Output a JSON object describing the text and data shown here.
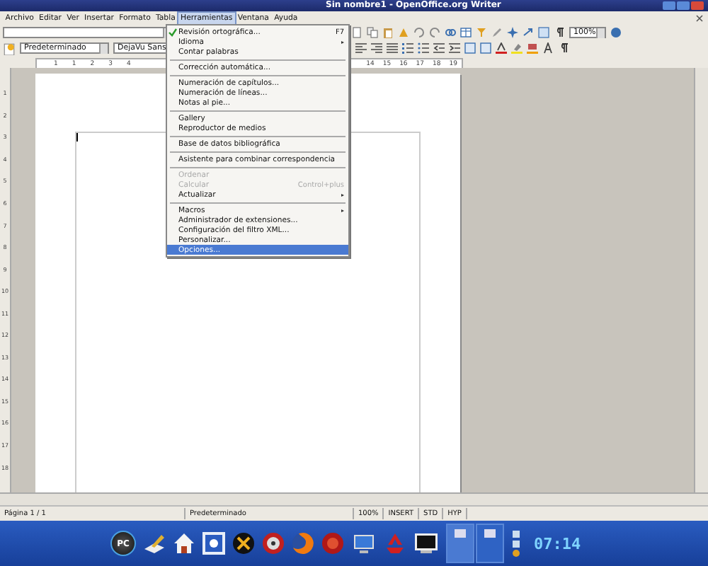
{
  "window": {
    "title": "Sin nombre1 - OpenOffice.org Writer"
  },
  "menu_bar": [
    {
      "label": "Archivo",
      "selected": false
    },
    {
      "label": "Editar",
      "selected": false
    },
    {
      "label": "Ver",
      "selected": false
    },
    {
      "label": "Insertar",
      "selected": false
    },
    {
      "label": "Formato",
      "selected": false
    },
    {
      "label": "Tabla",
      "selected": false
    },
    {
      "label": "Herramientas",
      "selected": true
    },
    {
      "label": "Ventana",
      "selected": false
    },
    {
      "label": "Ayuda",
      "selected": false
    }
  ],
  "toolbar": {
    "zoom": "100%"
  },
  "formatting": {
    "paragraph_style": "Predeterminado",
    "font_name": "DejaVu Sans"
  },
  "ruler": {
    "left_marks": [
      "1",
      "1",
      "2",
      "3",
      "4"
    ],
    "right_marks": [
      "14",
      "15",
      "16",
      "17",
      "18",
      "19"
    ],
    "vertical_marks": [
      "1",
      "2",
      "3",
      "4",
      "5",
      "6",
      "7",
      "8",
      "9",
      "10",
      "11",
      "12",
      "13",
      "14",
      "15",
      "16",
      "17",
      "18"
    ]
  },
  "open_menu": [
    {
      "kind": "item",
      "label": "Revisión ortográfica...",
      "shortcut": "F7",
      "submenu": false,
      "disabled": false,
      "selected": false,
      "icon": true
    },
    {
      "kind": "item",
      "label": "Idioma",
      "submenu": true,
      "disabled": false,
      "selected": false
    },
    {
      "kind": "item",
      "label": "Contar palabras",
      "submenu": false,
      "disabled": false,
      "selected": false
    },
    {
      "kind": "separator"
    },
    {
      "kind": "item",
      "label": "Corrección automática...",
      "submenu": false,
      "disabled": false,
      "selected": false
    },
    {
      "kind": "separator"
    },
    {
      "kind": "item",
      "label": "Numeración de capítulos...",
      "submenu": false,
      "disabled": false,
      "selected": false
    },
    {
      "kind": "item",
      "label": "Numeración de líneas...",
      "submenu": false,
      "disabled": false,
      "selected": false
    },
    {
      "kind": "item",
      "label": "Notas al pie...",
      "submenu": false,
      "disabled": false,
      "selected": false
    },
    {
      "kind": "separator"
    },
    {
      "kind": "item",
      "label": "Gallery",
      "submenu": false,
      "disabled": false,
      "selected": false
    },
    {
      "kind": "item",
      "label": "Reproductor de medios",
      "submenu": false,
      "disabled": false,
      "selected": false
    },
    {
      "kind": "separator"
    },
    {
      "kind": "item",
      "label": "Base de datos bibliográfica",
      "submenu": false,
      "disabled": false,
      "selected": false
    },
    {
      "kind": "separator"
    },
    {
      "kind": "item",
      "label": "Asistente para combinar correspondencia",
      "submenu": false,
      "disabled": false,
      "selected": false
    },
    {
      "kind": "separator"
    },
    {
      "kind": "item",
      "label": "Ordenar",
      "submenu": false,
      "disabled": true,
      "selected": false
    },
    {
      "kind": "item",
      "label": "Calcular",
      "shortcut": "Control+plus",
      "submenu": false,
      "disabled": true,
      "selected": false
    },
    {
      "kind": "item",
      "label": "Actualizar",
      "submenu": true,
      "disabled": false,
      "selected": false
    },
    {
      "kind": "separator"
    },
    {
      "kind": "item",
      "label": "Macros",
      "submenu": true,
      "disabled": false,
      "selected": false
    },
    {
      "kind": "item",
      "label": "Administrador de extensiones...",
      "submenu": false,
      "disabled": false,
      "selected": false
    },
    {
      "kind": "item",
      "label": "Configuración del filtro XML...",
      "submenu": false,
      "disabled": false,
      "selected": false
    },
    {
      "kind": "item",
      "label": "Personalizar...",
      "submenu": false,
      "disabled": false,
      "selected": false
    },
    {
      "kind": "item",
      "label": "Opciones...",
      "submenu": false,
      "disabled": false,
      "selected": true
    }
  ],
  "status_bar": {
    "page": "Página 1 / 1",
    "style": "Predeterminado",
    "zoom": "100%",
    "mode": "INSERT",
    "selection": "STD",
    "hyperlink": "HYP"
  },
  "taskbar": {
    "pc_label": "PC",
    "clock": "07:14"
  }
}
